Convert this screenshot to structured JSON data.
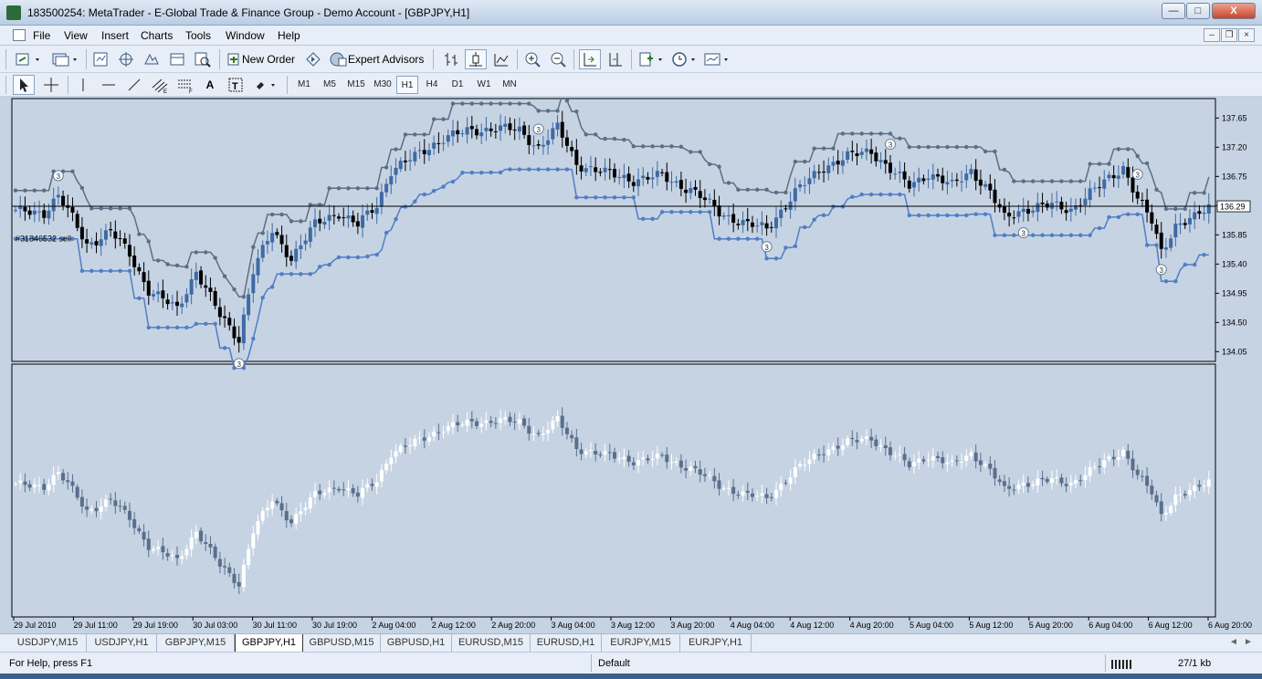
{
  "window": {
    "title": "183500254: MetaTrader - E-Global Trade & Finance Group - Demo Account - [GBPJPY,H1]",
    "minimize_glyph": "—",
    "maximize_glyph": "□",
    "close_glyph": "X"
  },
  "menu": {
    "items": [
      "File",
      "View",
      "Insert",
      "Charts",
      "Tools",
      "Window",
      "Help"
    ],
    "mdi_min": "–",
    "mdi_restore": "❐",
    "mdi_close": "×"
  },
  "toolbar": {
    "new_order": "New Order",
    "expert_advisors": "Expert Advisors",
    "text_tool": "A",
    "text_label_tool": "T"
  },
  "timeframes": {
    "items": [
      "M1",
      "M5",
      "M15",
      "M30",
      "H1",
      "H4",
      "D1",
      "W1",
      "MN"
    ],
    "active": "H1"
  },
  "chart": {
    "order_label": "#31846532 sell",
    "current_price": "136.29",
    "price_ticks": [
      "137.65",
      "137.20",
      "136.75",
      "136.30",
      "135.85",
      "135.40",
      "134.95",
      "134.50",
      "134.05"
    ],
    "time_labels": [
      "29 Jul 2010",
      "29 Jul 11:00",
      "29 Jul 19:00",
      "30 Jul 03:00",
      "30 Jul 11:00",
      "30 Jul 19:00",
      "2 Aug 04:00",
      "2 Aug 12:00",
      "2 Aug 20:00",
      "3 Aug 04:00",
      "3 Aug 12:00",
      "3 Aug 20:00",
      "4 Aug 04:00",
      "4 Aug 12:00",
      "4 Aug 20:00",
      "5 Aug 04:00",
      "5 Aug 12:00",
      "5 Aug 20:00",
      "6 Aug 04:00",
      "6 Aug 12:00",
      "6 Aug 20:00"
    ],
    "marker_label": "3",
    "colors": {
      "background": "#c6d3e3",
      "bull": "#3f6aa4",
      "bear": "#000000",
      "stop_upper": "#5d6e84",
      "stop_lower": "#4f7ec4",
      "osc_up": "#ffffff",
      "osc_down": "#5a6f8c"
    }
  },
  "chart_data": {
    "type": "candlestick",
    "symbol": "GBPJPY",
    "timeframe": "H1",
    "ylim": [
      133.9,
      137.95
    ],
    "current_price": 136.29,
    "anchors": [
      [
        0,
        136.2
      ],
      [
        6,
        136.2
      ],
      [
        9,
        136.45
      ],
      [
        12,
        136.1
      ],
      [
        15,
        135.7
      ],
      [
        20,
        135.9
      ],
      [
        24,
        135.55
      ],
      [
        28,
        135.0
      ],
      [
        34,
        134.7
      ],
      [
        38,
        135.3
      ],
      [
        43,
        134.6
      ],
      [
        47,
        134.25
      ],
      [
        50,
        135.3
      ],
      [
        54,
        135.9
      ],
      [
        58,
        135.5
      ],
      [
        63,
        136.0
      ],
      [
        68,
        136.2
      ],
      [
        72,
        136.0
      ],
      [
        76,
        136.3
      ],
      [
        79,
        136.85
      ],
      [
        84,
        137.05
      ],
      [
        90,
        137.35
      ],
      [
        96,
        137.45
      ],
      [
        101,
        137.5
      ],
      [
        106,
        137.45
      ],
      [
        110,
        137.2
      ],
      [
        114,
        137.5
      ],
      [
        118,
        136.95
      ],
      [
        124,
        136.8
      ],
      [
        130,
        136.7
      ],
      [
        136,
        136.75
      ],
      [
        142,
        136.55
      ],
      [
        148,
        136.2
      ],
      [
        154,
        136.0
      ],
      [
        158,
        135.95
      ],
      [
        164,
        136.5
      ],
      [
        170,
        136.9
      ],
      [
        175,
        137.05
      ],
      [
        180,
        137.15
      ],
      [
        184,
        136.85
      ],
      [
        188,
        136.6
      ],
      [
        192,
        136.8
      ],
      [
        197,
        136.6
      ],
      [
        201,
        136.85
      ],
      [
        205,
        136.5
      ],
      [
        208,
        136.1
      ],
      [
        212,
        136.25
      ],
      [
        218,
        136.3
      ],
      [
        222,
        136.25
      ],
      [
        228,
        136.6
      ],
      [
        233,
        136.9
      ],
      [
        236,
        136.4
      ],
      [
        239,
        136.05
      ],
      [
        241,
        135.6
      ],
      [
        244,
        136.0
      ],
      [
        248,
        136.1
      ],
      [
        251,
        136.29
      ]
    ]
  }
}
